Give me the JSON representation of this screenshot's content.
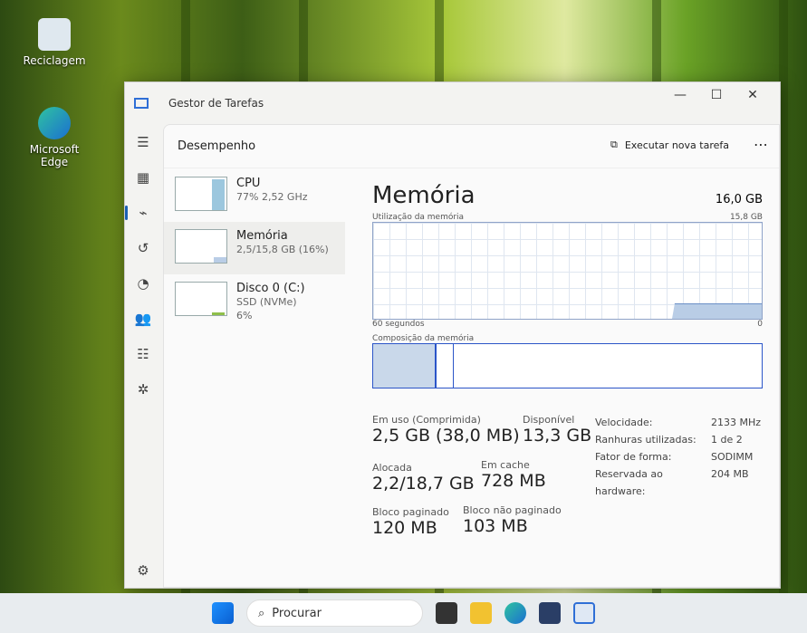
{
  "desktop": {
    "icons": [
      {
        "label": "Reciclagem"
      },
      {
        "label": "Microsoft Edge"
      }
    ]
  },
  "window": {
    "title": "Gestor de Tarefas",
    "controls": {
      "minimize": "—",
      "maximize": "☐",
      "close": "✕"
    }
  },
  "header": {
    "title": "Desempenho",
    "run_task": "Executar nova tarefa",
    "more": "⋯"
  },
  "sidebar": {
    "items": [
      {
        "title": "CPU",
        "sub1": "77%  2,52 GHz",
        "sub2": ""
      },
      {
        "title": "Memória",
        "sub1": "2,5/15,8 GB (16%)",
        "sub2": ""
      },
      {
        "title": "Disco 0 (C:)",
        "sub1": "SSD (NVMe)",
        "sub2": "6%"
      }
    ]
  },
  "main": {
    "title": "Memória",
    "total": "16,0 GB",
    "usage_label": "Utilização da memória",
    "usage_max": "15,8 GB",
    "time_label": "60 segundos",
    "zero": "0",
    "composition_label": "Composição da memória",
    "stats": {
      "in_use_label": "Em uso (Comprimida)",
      "in_use": "2,5 GB (38,0 MB)",
      "available_label": "Disponível",
      "available": "13,3 GB",
      "committed_label": "Alocada",
      "committed": "2,2/18,7 GB",
      "cached_label": "Em cache",
      "cached": "728 MB",
      "paged_label": "Bloco paginado",
      "paged": "120 MB",
      "nonpaged_label": "Bloco não paginado",
      "nonpaged": "103 MB"
    },
    "details": [
      {
        "k": "Velocidade:",
        "v": "2133 MHz"
      },
      {
        "k": "Ranhuras utilizadas:",
        "v": "1 de 2"
      },
      {
        "k": "Fator de forma:",
        "v": "SODIMM"
      },
      {
        "k": "Reservada ao hardware:",
        "v": "204 MB"
      }
    ],
    "usage_percent": 16
  },
  "taskbar": {
    "search": "Procurar"
  }
}
